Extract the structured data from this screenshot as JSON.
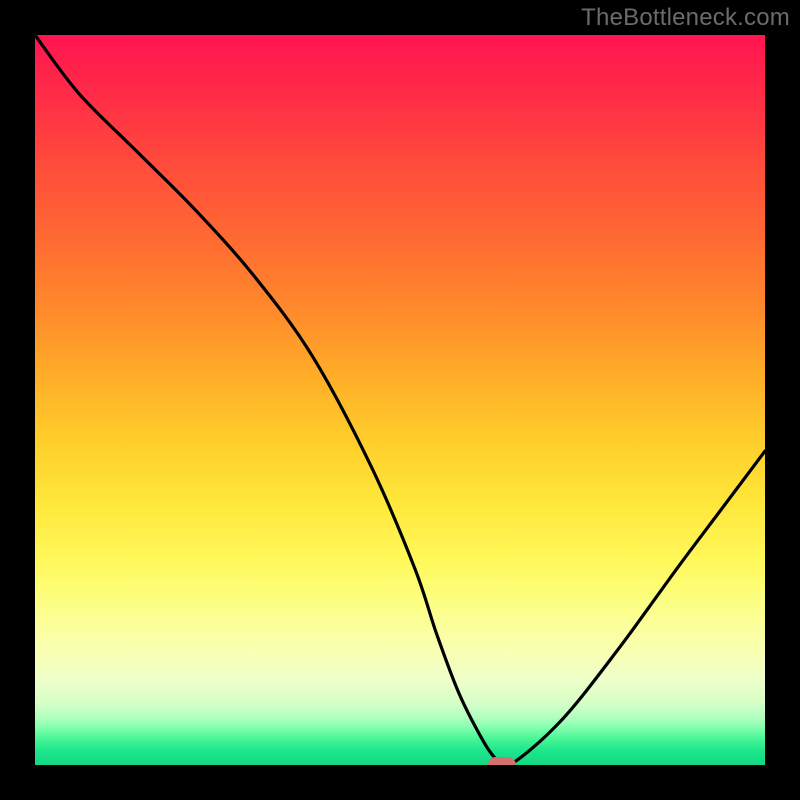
{
  "watermark": "TheBottleneck.com",
  "chart_data": {
    "type": "line",
    "title": "",
    "xlabel": "",
    "ylabel": "",
    "xlim": [
      0,
      100
    ],
    "ylim": [
      0,
      100
    ],
    "x": [
      0,
      6,
      14,
      22,
      30,
      38,
      46,
      52,
      55,
      58,
      61,
      63,
      65,
      72,
      80,
      88,
      94,
      100
    ],
    "values": [
      100,
      92,
      84,
      76,
      67,
      56,
      41,
      27,
      18,
      10,
      4,
      1,
      0,
      6,
      16,
      27,
      35,
      43
    ],
    "marker": {
      "x": 64,
      "y": 0
    },
    "note": "Smooth V-shaped curve; left branch starts at top-left descending convexly to a minimum near x≈64 at the baseline, right branch rises roughly linearly to about 43% height at the right edge. Y-axis inverted visually (higher value = higher on chart)."
  },
  "colors": {
    "frame": "#000000",
    "curve": "#000000",
    "marker": "#d2716f",
    "watermark": "#6b6b6b"
  }
}
